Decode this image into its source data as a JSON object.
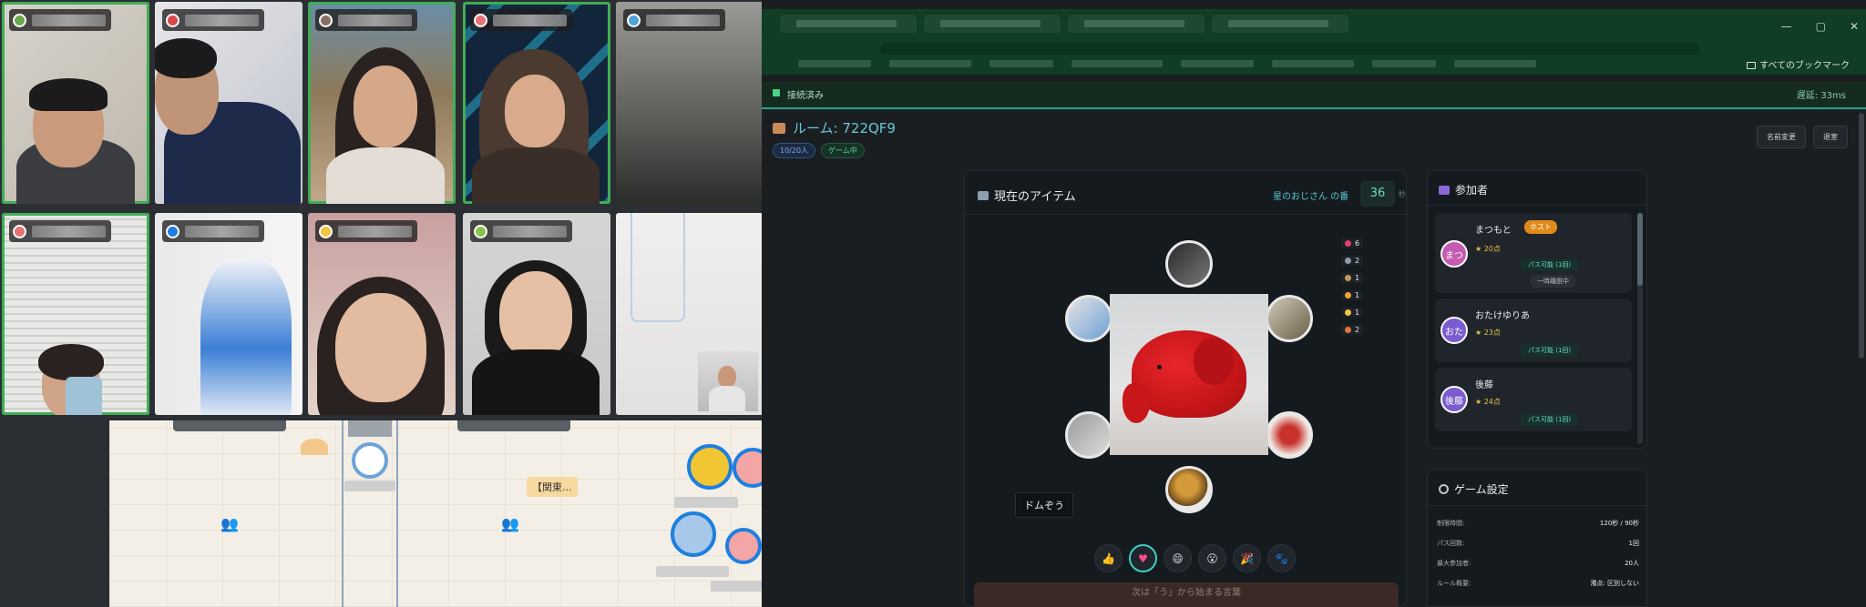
{
  "browser": {
    "window_controls": [
      "—",
      "▢",
      "✕"
    ],
    "all_bookmarks": "すべてのブックマーク"
  },
  "app": {
    "connection_status": "接続済み",
    "latency": "遅延: 33ms",
    "room_title": "ルーム: 722QF9",
    "chip_players": "10/20人",
    "chip_state": "ゲーム中",
    "btn_rename": "名前変更",
    "btn_leave": "退室"
  },
  "game": {
    "title": "現在のアイテム",
    "turn": "星のおじさん の番",
    "timer": "36",
    "timer_unit": "秒",
    "name_label": "ドムぞう",
    "reactions": [
      {
        "count": "6",
        "color": "#e0406a"
      },
      {
        "count": "2",
        "color": "#8e9aa6"
      },
      {
        "count": "1",
        "color": "#c59a5a"
      },
      {
        "count": "1",
        "color": "#f1a233"
      },
      {
        "count": "1",
        "color": "#f4c542"
      },
      {
        "count": "2",
        "color": "#e2763a"
      }
    ],
    "emoji_buttons": [
      "👍",
      "♥",
      "😄",
      "😮",
      "🎉",
      "🐾"
    ],
    "footer": "次は「う」から始まる言葉"
  },
  "participants": {
    "title": "参加者",
    "list": [
      {
        "name": "まつもと",
        "avatar": "まつ",
        "points": "★ 20点",
        "host": "ホスト",
        "pass": "パス可能 (1回)",
        "status": "一時離脱中",
        "color": "#c55bb0"
      },
      {
        "name": "おたけゆりあ",
        "avatar": "おた",
        "points": "★ 23点",
        "pass": "パス可能 (1回)",
        "color": "#7b5bd0"
      },
      {
        "name": "後藤",
        "avatar": "後藤",
        "points": "★ 24点",
        "pass": "パス可能 (1回)",
        "color": "#7b5bd0"
      }
    ]
  },
  "settings": {
    "title": "ゲーム設定",
    "rows": [
      {
        "label": "制限時間:",
        "value": "120秒 / 90秒"
      },
      {
        "label": "パス回数:",
        "value": "1回"
      },
      {
        "label": "最大参加者:",
        "value": "20人"
      },
      {
        "label": "ルール概要:",
        "value": "濁点: 区別しない"
      }
    ]
  },
  "left": {
    "map_tag": "【関東..."
  }
}
